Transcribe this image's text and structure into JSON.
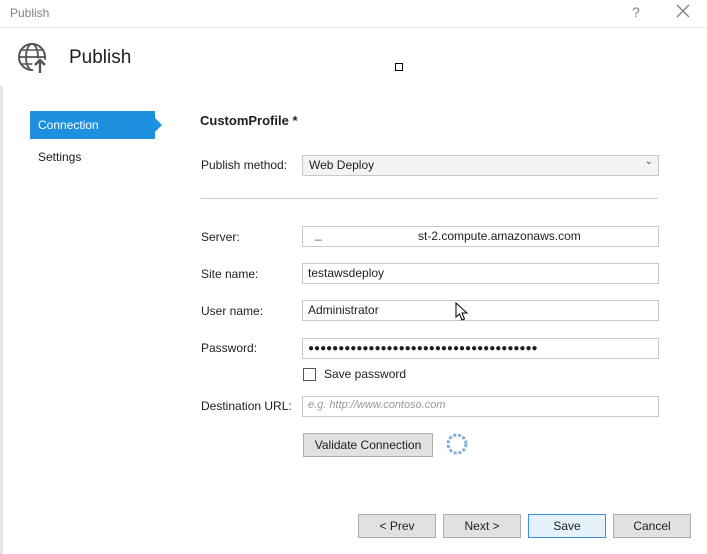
{
  "window": {
    "title": "Publish",
    "help_glyph": "?",
    "close_icon": "close-icon"
  },
  "header": {
    "title": "Publish",
    "icon": "globe-publish-icon"
  },
  "nav": {
    "items": [
      {
        "label": "Connection",
        "active": true
      },
      {
        "label": "Settings",
        "active": false
      }
    ]
  },
  "profile": {
    "title": "CustomProfile *"
  },
  "form": {
    "publish_method": {
      "label": "Publish method:",
      "value": "Web Deploy"
    },
    "server": {
      "label": "Server:",
      "value_visible": "st-2.compute.amazonaws.com",
      "prefix_visible": "_"
    },
    "site_name": {
      "label": "Site name:",
      "value": "testawsdeploy"
    },
    "user_name": {
      "label": "User name:",
      "value": "Administrator"
    },
    "password": {
      "label": "Password:",
      "masked": "●●●●●●●●●●●●●●●●●●●●●●●●●●●●●●●●●●●●●●"
    },
    "save_password": {
      "label": "Save password",
      "checked": false
    },
    "destination_url": {
      "label": "Destination URL:",
      "placeholder": "e.g. http://www.contoso.com"
    }
  },
  "buttons": {
    "validate": "Validate Connection",
    "prev": "< Prev",
    "next": "Next >",
    "save": "Save",
    "cancel": "Cancel"
  },
  "colors": {
    "accent": "#1e90e0",
    "spinner": "#7fb2dd"
  }
}
